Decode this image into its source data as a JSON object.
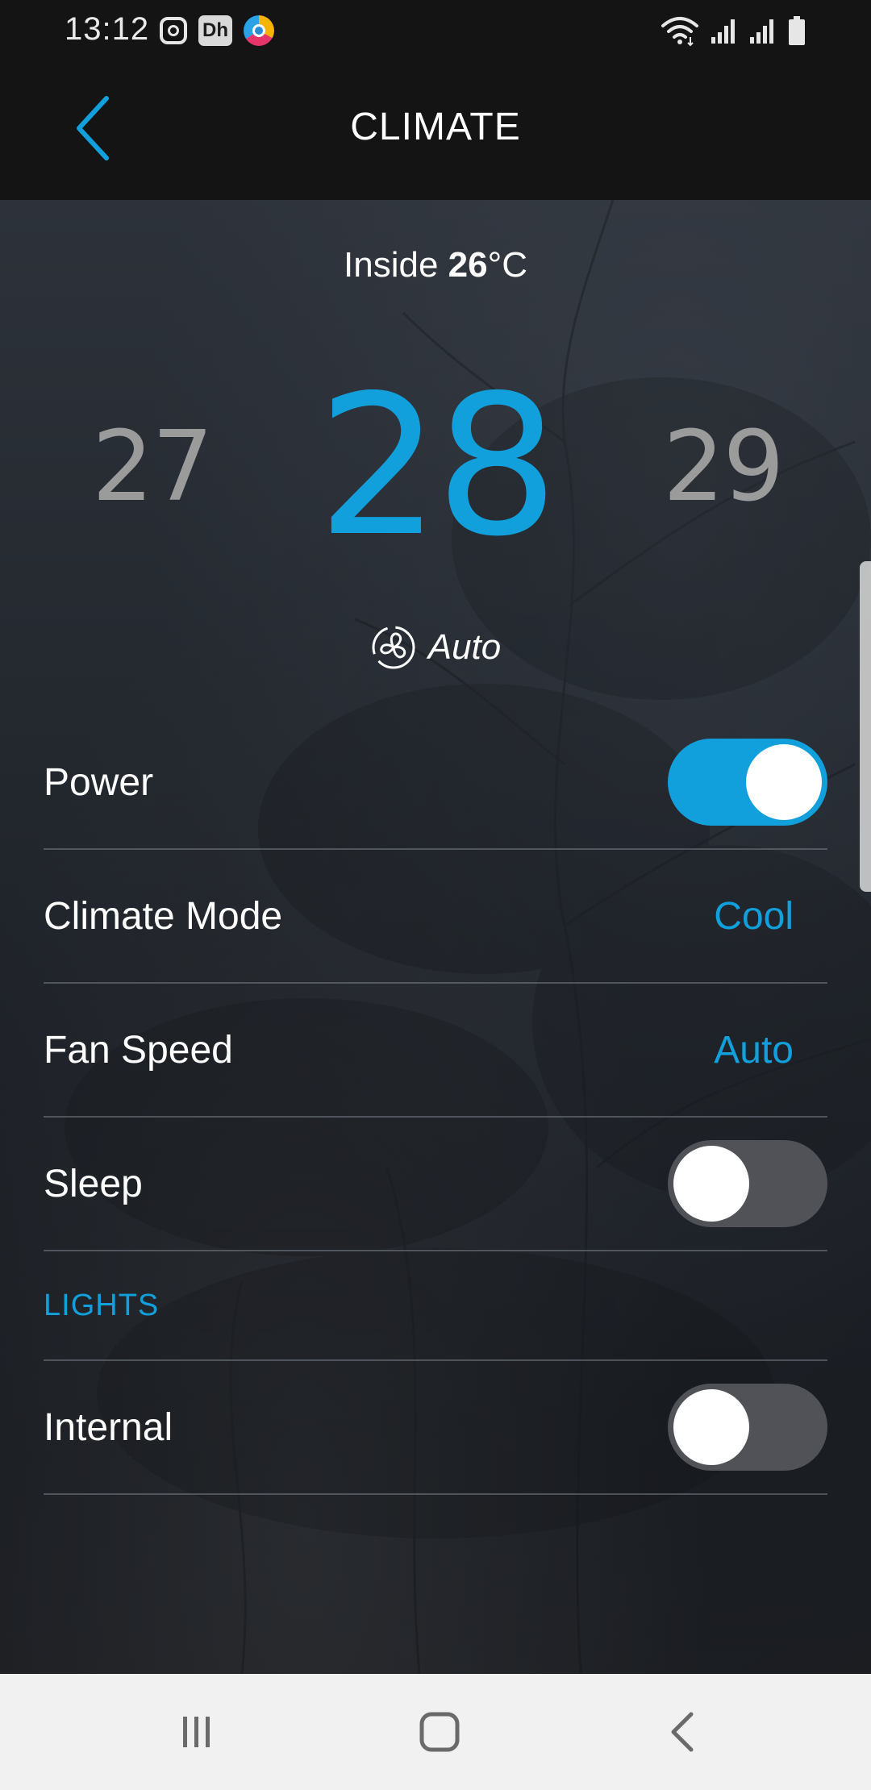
{
  "status_bar": {
    "time": "13:12",
    "app_icons": [
      "instagram-icon",
      "dh-app-icon",
      "browser-app-icon"
    ],
    "dh_label": "Dh",
    "right_icons": [
      "wifi-icon",
      "cell-signal-icon",
      "cell-signal-icon",
      "battery-icon"
    ]
  },
  "header": {
    "title": "CLIMATE",
    "back_icon": "chevron-left-icon"
  },
  "climate": {
    "inside_label": "Inside",
    "inside_value": "26",
    "inside_unit": "°C",
    "temp_prev": "27",
    "temp_current": "28",
    "temp_next": "29",
    "fan_icon": "fan-icon",
    "fan_label": "Auto"
  },
  "settings": {
    "power": {
      "label": "Power",
      "on": true
    },
    "climate_mode": {
      "label": "Climate Mode",
      "value": "Cool"
    },
    "fan_speed": {
      "label": "Fan Speed",
      "value": "Auto"
    },
    "sleep": {
      "label": "Sleep",
      "on": false
    }
  },
  "lights": {
    "section_title": "LIGHTS",
    "internal": {
      "label": "Internal",
      "on": false
    }
  },
  "nav": {
    "recents_icon": "recents-icon",
    "home_icon": "home-icon",
    "back_icon": "back-icon"
  },
  "colors": {
    "accent": "#11a0dc",
    "toggle_off": "#505257",
    "nav_bg": "#f1f1f1"
  }
}
